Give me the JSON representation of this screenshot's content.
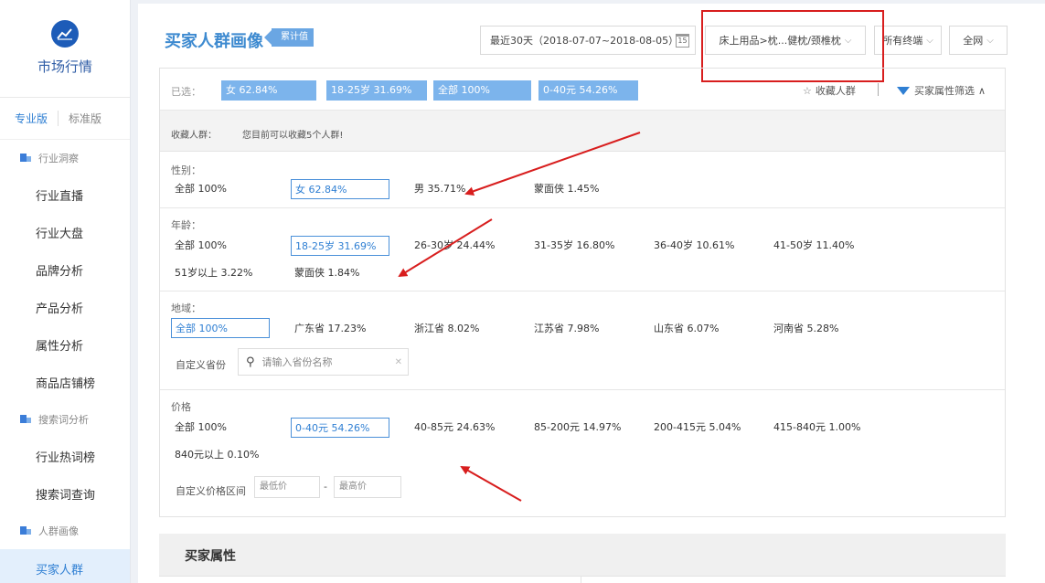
{
  "sidebar": {
    "title": "市场行情",
    "version_pro": "专业版",
    "version_std": "标准版",
    "groups": [
      {
        "label": "行业洞察",
        "items": [
          "行业直播",
          "行业大盘",
          "品牌分析",
          "产品分析",
          "属性分析",
          "商品店铺榜"
        ]
      },
      {
        "label": "搜索词分析",
        "items": [
          "行业热词榜",
          "搜索词查询"
        ]
      },
      {
        "label": "人群画像",
        "items": [
          "买家人群"
        ]
      }
    ],
    "active_item": "买家人群"
  },
  "header": {
    "title": "买家人群画像",
    "badge": "累计值",
    "date_range": "最近30天（2018-07-07~2018-08-05）",
    "calendar_day": "15",
    "category": "床上用品>枕...健枕/颈椎枕",
    "terminal": "所有终端",
    "network": "全网"
  },
  "selected": {
    "label": "已选：",
    "chips": [
      "女 62.84%",
      "18-25岁 31.69%",
      "全部 100%",
      "0-40元 54.26%"
    ],
    "fav_button": "收藏人群",
    "attr_button": "买家属性筛选"
  },
  "fav": {
    "label": "收藏人群：",
    "hint": "您目前可以收藏5个人群!"
  },
  "gender": {
    "title": "性别：",
    "options": [
      "全部  100%",
      "女  62.84%",
      "男  35.71%",
      "蒙面侠  1.45%"
    ]
  },
  "age": {
    "title": "年龄：",
    "options": [
      "全部  100%",
      "18-25岁  31.69%",
      "26-30岁  24.44%",
      "31-35岁  16.80%",
      "36-40岁  10.61%",
      "41-50岁  11.40%",
      "51岁以上  3.22%",
      "蒙面侠  1.84%"
    ]
  },
  "region": {
    "title": "地域：",
    "options": [
      "全部  100%",
      "广东省  17.23%",
      "浙江省  8.02%",
      "江苏省  7.98%",
      "山东省  6.07%",
      "河南省  5.28%"
    ],
    "custom_label": "自定义省份",
    "search_placeholder": "请输入省份名称"
  },
  "price": {
    "title": "价格",
    "options": [
      "全部  100%",
      "0-40元  54.26%",
      "40-85元  24.63%",
      "85-200元  14.97%",
      "200-415元  5.04%",
      "415-840元  1.00%",
      "840元以上  0.10%"
    ],
    "custom_label": "自定义价格区间",
    "min_placeholder": "最低价",
    "max_placeholder": "最高价",
    "dash": "-"
  },
  "bottom": {
    "title": "买家属性"
  },
  "colors": {
    "accent": "#2f7fd3",
    "chip": "#7cb4ec",
    "annotation": "#d81e1e"
  }
}
